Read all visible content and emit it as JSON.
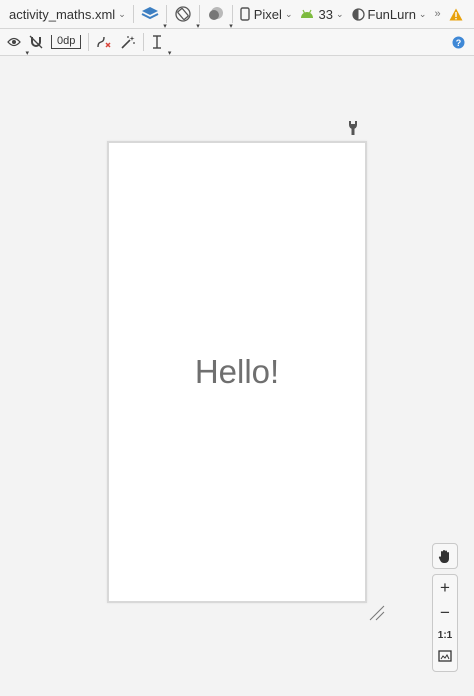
{
  "toolbar_top": {
    "file_name": "activity_maths.xml",
    "device": "Pixel",
    "api_level": "33",
    "theme": "FunLurn",
    "overflow_label": "»"
  },
  "toolbar_second": {
    "margin_value": "0dp"
  },
  "canvas": {
    "hello_text": "Hello!"
  },
  "zoom": {
    "zoom_in": "+",
    "zoom_out": "−",
    "actual_size": "1:1"
  },
  "colors": {
    "layers_icon": "#3d7fc2",
    "android_icon": "#7dbb3e",
    "warning_icon": "#e8a10b",
    "help_icon": "#3f88d6"
  }
}
